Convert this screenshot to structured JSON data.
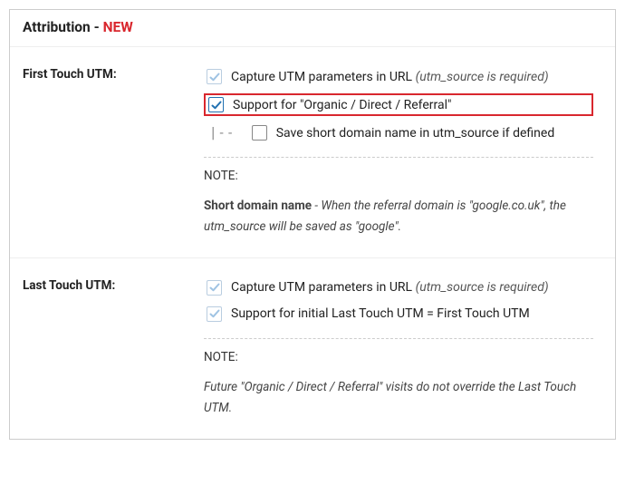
{
  "header": {
    "title": "Attribution - ",
    "badge": "NEW"
  },
  "first_touch": {
    "label": "First Touch UTM:",
    "opt1_text": "Capture UTM parameters in URL ",
    "opt1_hint": "(utm_source is required)",
    "opt2_text": "Support for \"Organic / Direct / Referral\"",
    "opt3_prefix": "|-- ",
    "opt3_text": "Save short domain name in utm_source if defined",
    "note_label": "NOTE:",
    "note_strong": "Short domain name",
    "note_body": " - When the referral domain is \"google.co.uk\", the utm_source will be saved as \"google\"."
  },
  "last_touch": {
    "label": "Last Touch UTM:",
    "opt1_text": "Capture UTM parameters in URL ",
    "opt1_hint": "(utm_source is required)",
    "opt2_text": "Support for initial Last Touch UTM = First Touch UTM",
    "note_label": "NOTE:",
    "note_body": "Future \"Organic / Direct / Referral\" visits do not override the Last Touch UTM."
  }
}
